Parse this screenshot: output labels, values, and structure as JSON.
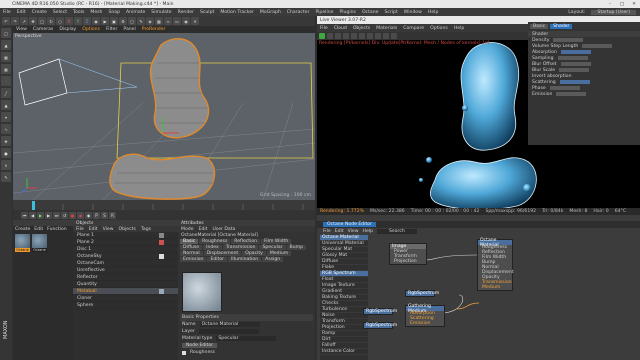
{
  "title_bar": {
    "title": "CINEMA 4D R16.050 Studio (RC - R16) - [Material Making.c4d *] - Main"
  },
  "menu": {
    "items": [
      "File",
      "Edit",
      "Create",
      "Select",
      "Tools",
      "Mesh",
      "Snap",
      "Animate",
      "Simulate",
      "Render",
      "Sculpt",
      "Motion Tracker",
      "MoGraph",
      "Character",
      "Pipeline",
      "Plugins",
      "Octane",
      "Script",
      "Window",
      "Help"
    ],
    "layout_label": "Layout:",
    "layout_value": "Startup (User)"
  },
  "viewport": {
    "menu": [
      "View",
      "Cameras",
      "Display",
      "Options",
      "Filter",
      "Panel",
      "ProRender"
    ],
    "label": "Perspective",
    "grid_label": "Grid Spacing : 100 cm"
  },
  "materials_panel": {
    "menu": [
      "Create",
      "Edit",
      "Function"
    ],
    "swatches": [
      {
        "name": "Octane"
      },
      {
        "name": "Octane"
      }
    ]
  },
  "objects_panel": {
    "title": "Objects",
    "menu": [
      "File",
      "Edit",
      "View",
      "Objects",
      "Tags"
    ],
    "rows": [
      "Plane 1",
      "Plane 2",
      "Disc 1",
      "OctaneSky",
      "OctaneCam",
      "Unreflective",
      "Reflector",
      "Quantity",
      "Metaball",
      "Cloner",
      "Sphere"
    ]
  },
  "attributes_panel": {
    "title": "Attributes",
    "menu": [
      "Mode",
      "Edit",
      "User Data"
    ],
    "subtitle": "OctaneMaterial [Octane Material]",
    "tabs": [
      "Basic",
      "Roughness",
      "Reflection",
      "Film Width",
      "Diffuse",
      "Index",
      "Transmission",
      "Specular",
      "Bump",
      "Normal",
      "Displacement",
      "Opacity",
      "Medium",
      "Emission",
      "Editor",
      "Illumination",
      "Assign"
    ],
    "section": "Basic Properties",
    "props": [
      {
        "label": "Name",
        "value": "Octane Material"
      },
      {
        "label": "Layer",
        "value": ""
      },
      {
        "label": "Material type",
        "value": "Specular"
      }
    ],
    "button": "Node Editor",
    "checkbox": "Roughness"
  },
  "render_window": {
    "title": "Live Viewer 3.07-R2",
    "menu": [
      "File",
      "Cloud",
      "Objects",
      "Materials",
      "Compare",
      "Options",
      "Help"
    ],
    "info": "Rendering [Pt/kernels] Div: Update[Pt/Kernel: Mesh / Nodes of kernels] 1/4",
    "status": {
      "rendering": "Rendering: 1.772%",
      "ms": "Ms/sec: 22.386",
      "time": "Time: 00 : 00 : 02/00 : 00 : 42",
      "spp": "Spp/maxspp: 96/6192",
      "tri": "Tri: 0/84k",
      "mesh": "Mesh: 8",
      "hair": "Hair: 0",
      "gpu": "64°C"
    }
  },
  "node_editor": {
    "title": "Octane Node Editor",
    "menu": [
      "File",
      "Edit",
      "View",
      "Help"
    ],
    "search": "Search",
    "list": [
      "Octane Material",
      "Universal Material",
      "Specular Mat",
      "Glossy Mat",
      "Diffuse",
      "Flake",
      "RGB Spectrum",
      "Float",
      "Image Texture",
      "Gradient",
      "Baking Texture",
      "Checks",
      "Turbulence",
      "Noise",
      "Transform",
      "Projection",
      "Ramp",
      "Dirt",
      "Falloff",
      "Instance Color",
      "Random Color",
      "Output Fractal"
    ],
    "nodes": {
      "material": {
        "title": "Octane Material",
        "ports": [
          "Roughness",
          "Reflection",
          "Film Width",
          "Bump",
          "Normal",
          "Displacement",
          "Opacity",
          "Transmission",
          "Medium"
        ]
      },
      "image": {
        "title": "Image",
        "ports": [
          "Power",
          "Transform",
          "Projection"
        ]
      },
      "mix": {
        "title": "Gathering Medium",
        "ports": [
          "Absorption",
          "Scattering",
          "Emission"
        ]
      },
      "rgb1": "RgbSpectrum",
      "rgb2": "RgbSpectrum",
      "rgb3": "RgbSpectrum"
    },
    "right": {
      "tabs": [
        "Basic",
        "Shader"
      ],
      "section": "Shader",
      "props": [
        "Density",
        "Volume Step Length",
        "Absorption",
        "Sampling",
        "Blur Offset",
        "Blur Scale",
        "Invert absorption",
        "Scattering",
        "Phase",
        "Emission"
      ]
    }
  },
  "watermark": "MAXON"
}
